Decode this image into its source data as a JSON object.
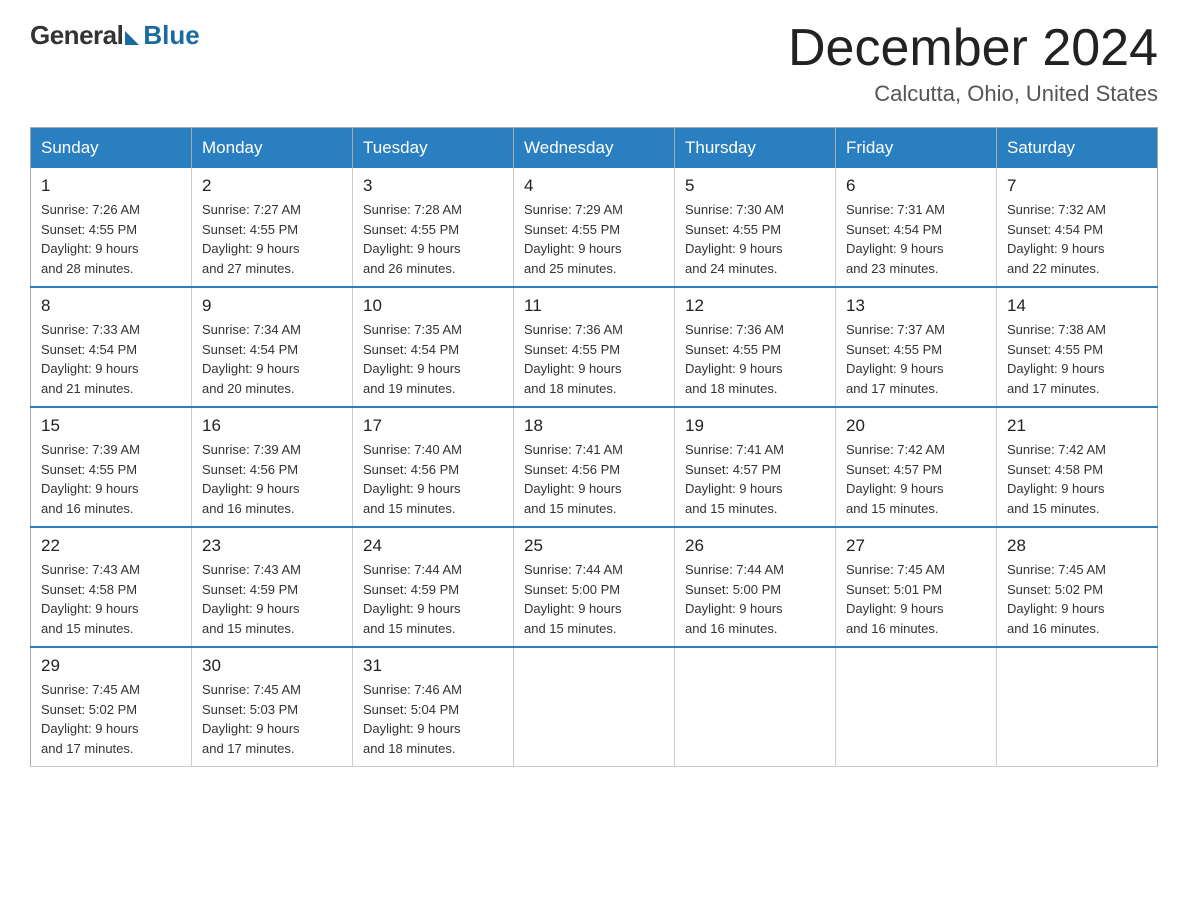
{
  "header": {
    "logo": {
      "general": "General",
      "blue": "Blue"
    },
    "title": "December 2024",
    "location": "Calcutta, Ohio, United States"
  },
  "weekdays": [
    "Sunday",
    "Monday",
    "Tuesday",
    "Wednesday",
    "Thursday",
    "Friday",
    "Saturday"
  ],
  "weeks": [
    [
      {
        "day": "1",
        "sunrise": "7:26 AM",
        "sunset": "4:55 PM",
        "daylight": "9 hours and 28 minutes."
      },
      {
        "day": "2",
        "sunrise": "7:27 AM",
        "sunset": "4:55 PM",
        "daylight": "9 hours and 27 minutes."
      },
      {
        "day": "3",
        "sunrise": "7:28 AM",
        "sunset": "4:55 PM",
        "daylight": "9 hours and 26 minutes."
      },
      {
        "day": "4",
        "sunrise": "7:29 AM",
        "sunset": "4:55 PM",
        "daylight": "9 hours and 25 minutes."
      },
      {
        "day": "5",
        "sunrise": "7:30 AM",
        "sunset": "4:55 PM",
        "daylight": "9 hours and 24 minutes."
      },
      {
        "day": "6",
        "sunrise": "7:31 AM",
        "sunset": "4:54 PM",
        "daylight": "9 hours and 23 minutes."
      },
      {
        "day": "7",
        "sunrise": "7:32 AM",
        "sunset": "4:54 PM",
        "daylight": "9 hours and 22 minutes."
      }
    ],
    [
      {
        "day": "8",
        "sunrise": "7:33 AM",
        "sunset": "4:54 PM",
        "daylight": "9 hours and 21 minutes."
      },
      {
        "day": "9",
        "sunrise": "7:34 AM",
        "sunset": "4:54 PM",
        "daylight": "9 hours and 20 minutes."
      },
      {
        "day": "10",
        "sunrise": "7:35 AM",
        "sunset": "4:54 PM",
        "daylight": "9 hours and 19 minutes."
      },
      {
        "day": "11",
        "sunrise": "7:36 AM",
        "sunset": "4:55 PM",
        "daylight": "9 hours and 18 minutes."
      },
      {
        "day": "12",
        "sunrise": "7:36 AM",
        "sunset": "4:55 PM",
        "daylight": "9 hours and 18 minutes."
      },
      {
        "day": "13",
        "sunrise": "7:37 AM",
        "sunset": "4:55 PM",
        "daylight": "9 hours and 17 minutes."
      },
      {
        "day": "14",
        "sunrise": "7:38 AM",
        "sunset": "4:55 PM",
        "daylight": "9 hours and 17 minutes."
      }
    ],
    [
      {
        "day": "15",
        "sunrise": "7:39 AM",
        "sunset": "4:55 PM",
        "daylight": "9 hours and 16 minutes."
      },
      {
        "day": "16",
        "sunrise": "7:39 AM",
        "sunset": "4:56 PM",
        "daylight": "9 hours and 16 minutes."
      },
      {
        "day": "17",
        "sunrise": "7:40 AM",
        "sunset": "4:56 PM",
        "daylight": "9 hours and 15 minutes."
      },
      {
        "day": "18",
        "sunrise": "7:41 AM",
        "sunset": "4:56 PM",
        "daylight": "9 hours and 15 minutes."
      },
      {
        "day": "19",
        "sunrise": "7:41 AM",
        "sunset": "4:57 PM",
        "daylight": "9 hours and 15 minutes."
      },
      {
        "day": "20",
        "sunrise": "7:42 AM",
        "sunset": "4:57 PM",
        "daylight": "9 hours and 15 minutes."
      },
      {
        "day": "21",
        "sunrise": "7:42 AM",
        "sunset": "4:58 PM",
        "daylight": "9 hours and 15 minutes."
      }
    ],
    [
      {
        "day": "22",
        "sunrise": "7:43 AM",
        "sunset": "4:58 PM",
        "daylight": "9 hours and 15 minutes."
      },
      {
        "day": "23",
        "sunrise": "7:43 AM",
        "sunset": "4:59 PM",
        "daylight": "9 hours and 15 minutes."
      },
      {
        "day": "24",
        "sunrise": "7:44 AM",
        "sunset": "4:59 PM",
        "daylight": "9 hours and 15 minutes."
      },
      {
        "day": "25",
        "sunrise": "7:44 AM",
        "sunset": "5:00 PM",
        "daylight": "9 hours and 15 minutes."
      },
      {
        "day": "26",
        "sunrise": "7:44 AM",
        "sunset": "5:00 PM",
        "daylight": "9 hours and 16 minutes."
      },
      {
        "day": "27",
        "sunrise": "7:45 AM",
        "sunset": "5:01 PM",
        "daylight": "9 hours and 16 minutes."
      },
      {
        "day": "28",
        "sunrise": "7:45 AM",
        "sunset": "5:02 PM",
        "daylight": "9 hours and 16 minutes."
      }
    ],
    [
      {
        "day": "29",
        "sunrise": "7:45 AM",
        "sunset": "5:02 PM",
        "daylight": "9 hours and 17 minutes."
      },
      {
        "day": "30",
        "sunrise": "7:45 AM",
        "sunset": "5:03 PM",
        "daylight": "9 hours and 17 minutes."
      },
      {
        "day": "31",
        "sunrise": "7:46 AM",
        "sunset": "5:04 PM",
        "daylight": "9 hours and 18 minutes."
      },
      null,
      null,
      null,
      null
    ]
  ],
  "labels": {
    "sunrise": "Sunrise:",
    "sunset": "Sunset:",
    "daylight": "Daylight:"
  }
}
